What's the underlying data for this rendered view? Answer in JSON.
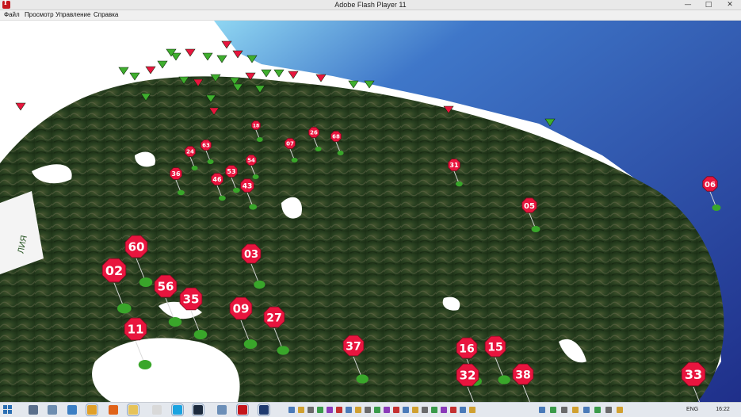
{
  "window": {
    "title": "Adobe Flash Player 11",
    "controls": {
      "minimize": "—",
      "maximize": "□",
      "close": "✕"
    }
  },
  "menu": [
    "Файл",
    "Просмотр",
    "Управление",
    "Справка"
  ],
  "map": {
    "ocean_color": "#2b44a8",
    "land_color": "#2f4722",
    "marker_color": "#e8153e",
    "pin_color": "#39a62a",
    "background_label": "ЛИЯ",
    "markers": [
      {
        "label": "02"
      },
      {
        "label": "60"
      },
      {
        "label": "56"
      },
      {
        "label": "35"
      },
      {
        "label": "11"
      },
      {
        "label": "09"
      },
      {
        "label": "27"
      },
      {
        "label": "03"
      },
      {
        "label": "37"
      },
      {
        "label": "16"
      },
      {
        "label": "15"
      },
      {
        "label": "32"
      },
      {
        "label": "38"
      },
      {
        "label": "33"
      },
      {
        "label": "05"
      },
      {
        "label": "06"
      },
      {
        "label": "31"
      },
      {
        "label": "43"
      },
      {
        "label": "46"
      },
      {
        "label": "53"
      },
      {
        "label": "36"
      },
      {
        "label": "24"
      },
      {
        "label": "63"
      },
      {
        "label": "54"
      },
      {
        "label": "07"
      },
      {
        "label": "26"
      },
      {
        "label": "68"
      },
      {
        "label": "18"
      }
    ]
  },
  "taskbar": {
    "language": "ENG",
    "time": "16:22",
    "apps": [
      "explorer",
      "skype",
      "steam",
      "flash",
      "photoshop"
    ]
  }
}
